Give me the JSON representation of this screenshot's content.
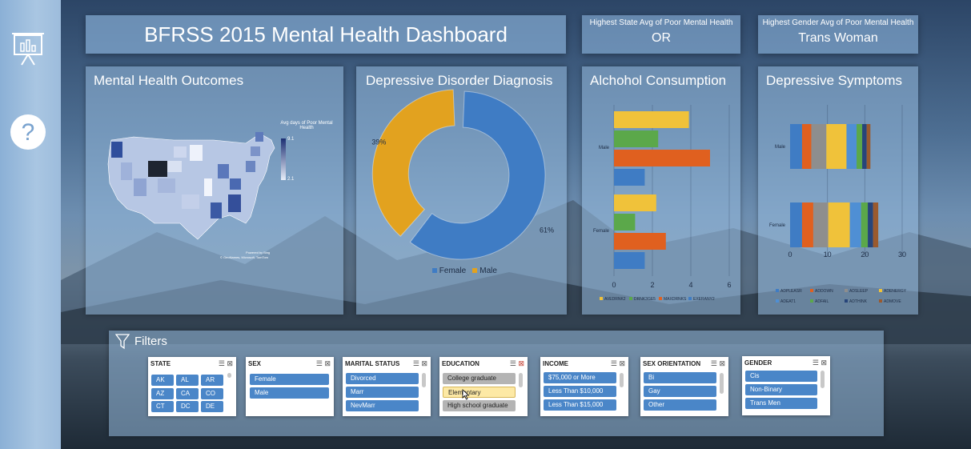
{
  "title": "BFRSS 2015 Mental Health Dashboard",
  "kpis": {
    "state_label": "Highest State Avg of Poor Mental Health",
    "state_value": "OR",
    "gender_label": "Highest Gender Avg of Poor Mental Health",
    "gender_value": "Trans Woman"
  },
  "sidebar": {
    "chart_icon": "presentation-chart-icon",
    "help_icon": "help-question-icon"
  },
  "map_panel": {
    "title": "Mental Health Outcomes",
    "legend_title": "Avg days of Poor Mental Health",
    "legend_max": "9.1",
    "legend_min": "2.1",
    "credit1": "Powered by Bing",
    "credit2": "© GeoNames, Microsoft, TomTom"
  },
  "donut_panel": {
    "title": "Depressive Disorder Diagnosis"
  },
  "alcohol_panel": {
    "title": "Alchohol Consumption"
  },
  "symptoms_panel": {
    "title": "Depressive Symptoms"
  },
  "filters": {
    "title": "Filters",
    "state": {
      "header": "STATE",
      "items": [
        "AK",
        "AL",
        "AR",
        "AZ",
        "CA",
        "CO",
        "CT",
        "DC",
        "DE"
      ]
    },
    "sex": {
      "header": "SEX",
      "items": [
        "Female",
        "Male"
      ]
    },
    "marital": {
      "header": "MARITAL STATUS",
      "items": [
        "Divorced",
        "Marr",
        "NevMarr"
      ]
    },
    "education": {
      "header": "EDUCATION",
      "items": [
        "College graduate",
        "Elementary",
        "High school graduate"
      ]
    },
    "income": {
      "header": "INCOME",
      "items": [
        "$75,000 or More",
        "Less Than $10,000",
        "Less Than $15,000"
      ]
    },
    "orientation": {
      "header": "SEX ORIENTATION",
      "items": [
        "Bi",
        "Gay",
        "Other"
      ]
    },
    "gender": {
      "header": "GENDER",
      "items": [
        "Cis",
        "Non-Binary",
        "Trans Men"
      ]
    }
  },
  "colors": {
    "blue": "#3f7cc4",
    "orange": "#e2a21f",
    "red": "#e0601f",
    "green": "#5ba84a",
    "yellow": "#f0c23a",
    "grey": "#8e8e8e",
    "darkblue": "#27457a",
    "brown": "#9a5a2e"
  },
  "chart_data": [
    {
      "type": "pie",
      "title": "Depressive Disorder Diagnosis",
      "categories": [
        "Female",
        "Male"
      ],
      "values": [
        61,
        39
      ],
      "labels": [
        "61%",
        "39%"
      ],
      "legend": "bottom"
    },
    {
      "type": "bar",
      "orientation": "horizontal",
      "title": "Alchohol Consumption",
      "categories": [
        "Male",
        "Female"
      ],
      "xlim": [
        0,
        6
      ],
      "xticks": [
        "0",
        "2",
        "4",
        "6"
      ],
      "series": [
        {
          "name": "AVEDRNK2",
          "color": "#f0c23a",
          "values": [
            3.9,
            2.2
          ]
        },
        {
          "name": "DRNK3GE5",
          "color": "#5ba84a",
          "values": [
            2.3,
            1.1
          ]
        },
        {
          "name": "MAXDRNKS",
          "color": "#e0601f",
          "values": [
            5.0,
            2.7
          ]
        },
        {
          "name": "EXERANY2",
          "color": "#3f7cc4",
          "values": [
            1.6,
            1.6
          ]
        }
      ],
      "legend": "bottom"
    },
    {
      "type": "bar",
      "orientation": "horizontal",
      "stacked": true,
      "title": "Depressive Symptoms",
      "categories": [
        "Male",
        "Female"
      ],
      "xlim": [
        0,
        30
      ],
      "xticks": [
        "0",
        "10",
        "20",
        "30"
      ],
      "series": [
        {
          "name": "ADPLEASR",
          "color": "#3f7cc4",
          "values": [
            3.2,
            3.2
          ]
        },
        {
          "name": "ADDOWN",
          "color": "#e0601f",
          "values": [
            2.5,
            3.0
          ]
        },
        {
          "name": "ADSLEEP",
          "color": "#8e8e8e",
          "values": [
            4.0,
            4.0
          ]
        },
        {
          "name": "ADENERGY",
          "color": "#f0c23a",
          "values": [
            5.4,
            5.8
          ]
        },
        {
          "name": "ADEAT1",
          "color": "#4f8fd4",
          "values": [
            2.7,
            3.0
          ]
        },
        {
          "name": "ADFAIL",
          "color": "#5ba84a",
          "values": [
            1.5,
            1.8
          ]
        },
        {
          "name": "ADTHINK",
          "color": "#27457a",
          "values": [
            1.2,
            1.4
          ]
        },
        {
          "name": "ADMOVE",
          "color": "#9a5a2e",
          "values": [
            1.0,
            1.4
          ]
        }
      ],
      "legend": "bottom"
    }
  ]
}
